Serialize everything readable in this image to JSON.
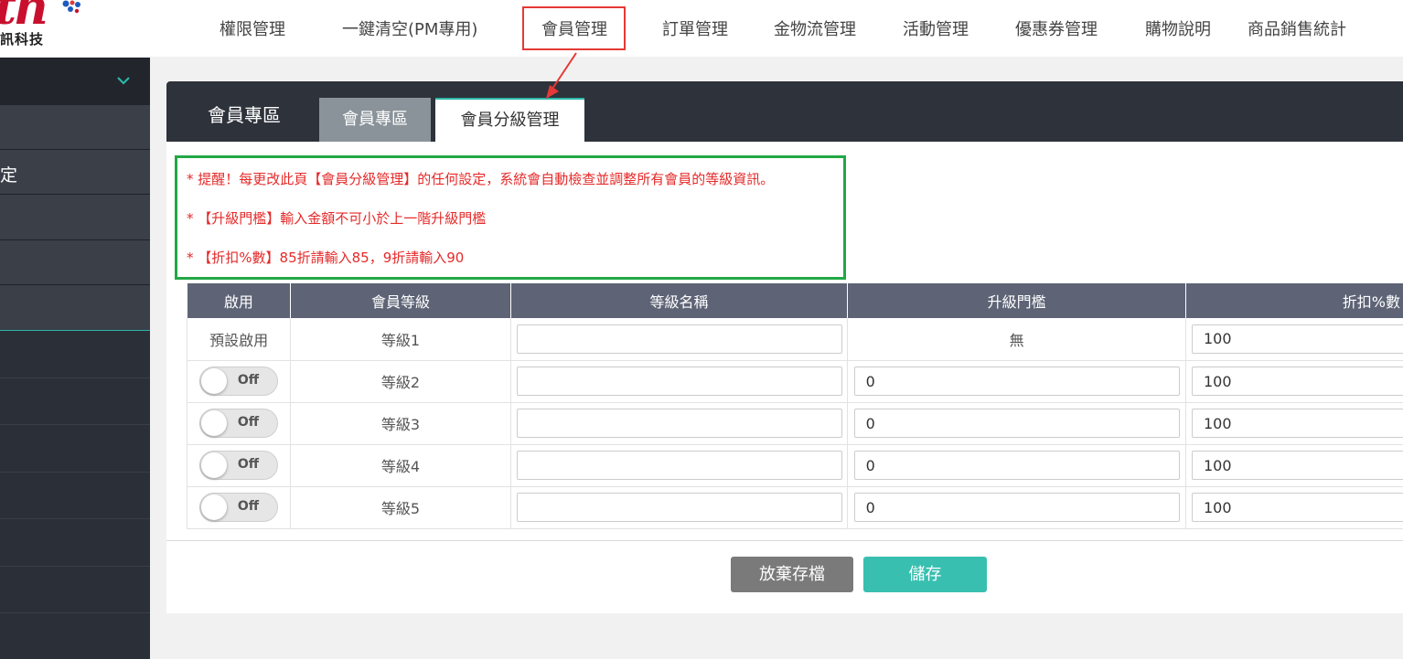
{
  "logo": {
    "brand_text": "訊科技",
    "mark_text": "th"
  },
  "nav": {
    "items": [
      {
        "label": "權限管理"
      },
      {
        "label": "一鍵清空(PM專用)"
      },
      {
        "label": "會員管理"
      },
      {
        "label": "訂單管理"
      },
      {
        "label": "金物流管理"
      },
      {
        "label": "活動管理"
      },
      {
        "label": "優惠券管理"
      },
      {
        "label": "購物說明"
      },
      {
        "label": "商品銷售統計"
      }
    ],
    "active": "會員管理"
  },
  "sidebar": {
    "items": [
      {
        "label": ""
      },
      {
        "label": "定"
      },
      {
        "label": ""
      },
      {
        "label": ""
      },
      {
        "label": ""
      }
    ]
  },
  "panel": {
    "title": "會員專區",
    "tabs": [
      {
        "label": "會員專區"
      },
      {
        "label": "會員分級管理"
      }
    ],
    "active_tab": "會員分級管理"
  },
  "notice": {
    "lines": [
      "* 提醒！每更改此頁【會員分級管理】的任何設定，系統會自動檢查並調整所有會員的等級資訊。",
      "* 【升級門檻】輸入金額不可小於上一階升級門檻",
      "* 【折扣%數】85折請輸入85，9折請輸入90"
    ]
  },
  "table": {
    "headers": [
      "啟用",
      "會員等級",
      "等級名稱",
      "升級門檻",
      "折扣%數"
    ],
    "rows": [
      {
        "enable": "預設啟用",
        "level": "等級1",
        "name": "",
        "threshold": "無",
        "discount": "100"
      },
      {
        "enable": "Off",
        "level": "等級2",
        "name": "",
        "threshold": "0",
        "discount": "100"
      },
      {
        "enable": "Off",
        "level": "等級3",
        "name": "",
        "threshold": "0",
        "discount": "100"
      },
      {
        "enable": "Off",
        "level": "等級4",
        "name": "",
        "threshold": "0",
        "discount": "100"
      },
      {
        "enable": "Off",
        "level": "等級5",
        "name": "",
        "threshold": "0",
        "discount": "100"
      }
    ]
  },
  "buttons": {
    "discard": "放棄存檔",
    "save": "儲存"
  },
  "colors": {
    "accent": "#2ab6a8",
    "highlight_nav": "#e53935",
    "notice_border": "#22a845",
    "notice_text": "#e52a2a",
    "save_button": "#38bfb0",
    "discard_button": "#7a7a7a"
  }
}
